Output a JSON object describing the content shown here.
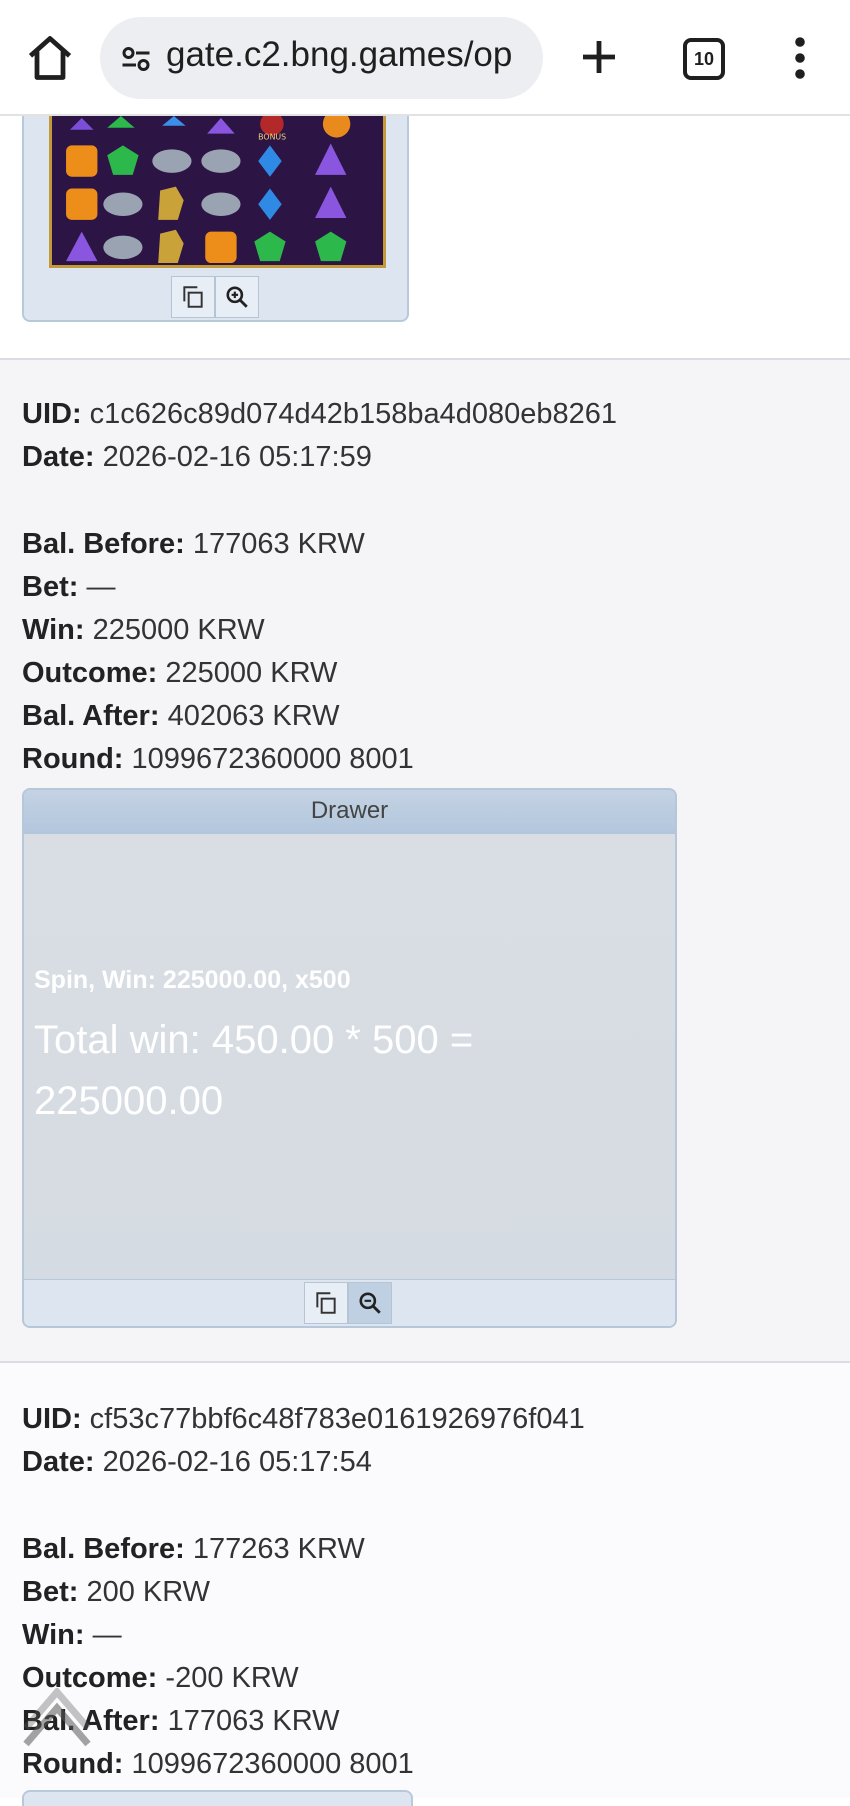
{
  "browser": {
    "url": "gate.c2.bng.games/op",
    "tab_count": "10"
  },
  "records": [
    {
      "uid_label": "UID:",
      "uid": "c1c626c89d074d42b158ba4d080eb8261",
      "date_label": "Date:",
      "date": "2026-02-16 05:17:59",
      "bal_before_label": "Bal. Before:",
      "bal_before": "177063 KRW",
      "bet_label": "Bet:",
      "bet": "—",
      "win_label": "Win:",
      "win": "225000 KRW",
      "outcome_label": "Outcome:",
      "outcome": "225000 KRW",
      "bal_after_label": "Bal. After:",
      "bal_after": "402063 KRW",
      "round_label": "Round:",
      "round": "1099672360000 8001",
      "drawer": {
        "title": "Drawer",
        "spin_line": "Spin, Win: 225000.00, x500",
        "total_line": "Total win: 450.00 * 500 = 225000.00"
      }
    },
    {
      "uid_label": "UID:",
      "uid": "cf53c77bbf6c48f783e0161926976f041",
      "date_label": "Date:",
      "date": "2026-02-16 05:17:54",
      "bal_before_label": "Bal. Before:",
      "bal_before": "177263 KRW",
      "bet_label": "Bet:",
      "bet": "200 KRW",
      "win_label": "Win:",
      "win": "—",
      "outcome_label": "Outcome:",
      "outcome": "-200 KRW",
      "bal_after_label": "Bal. After:",
      "bal_after": "177063 KRW",
      "round_label": "Round:",
      "round": "1099672360000 8001"
    }
  ],
  "colors": {
    "accent": "#b6c7da",
    "section_bg": "#f5f5f8"
  }
}
